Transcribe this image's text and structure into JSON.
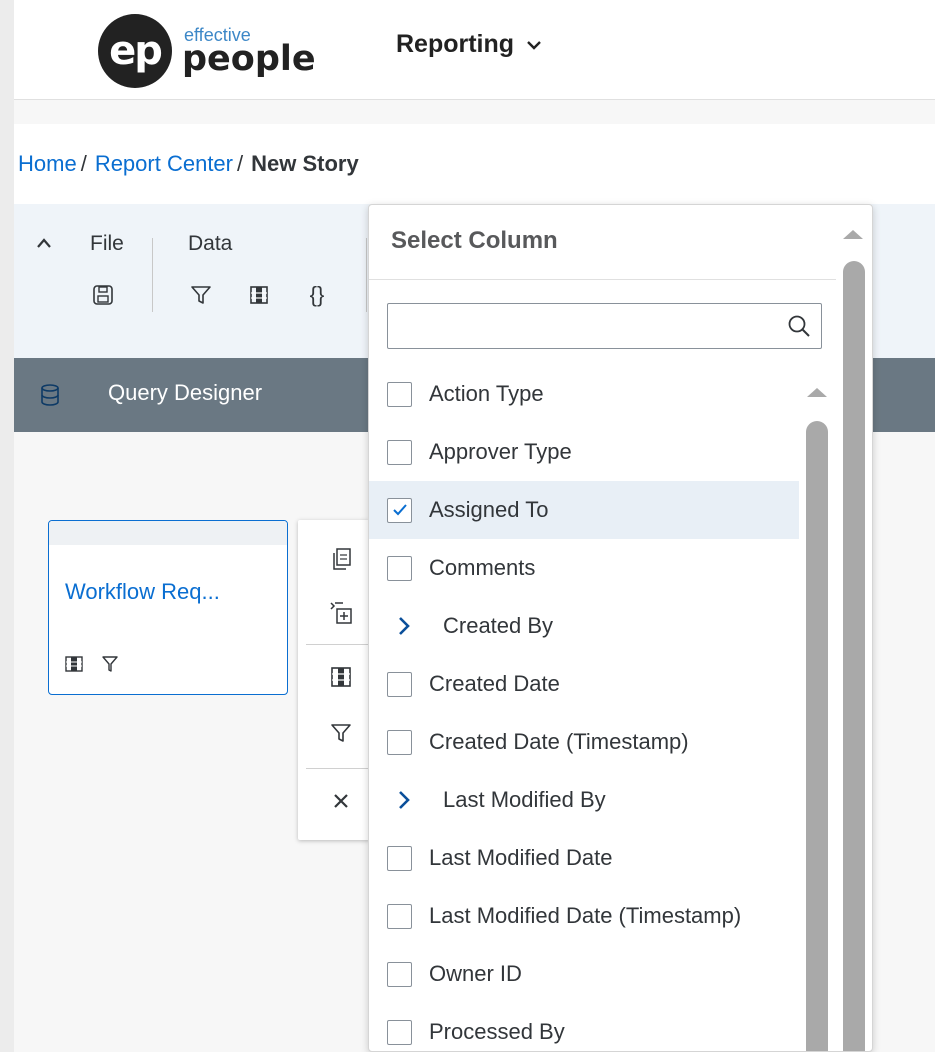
{
  "header": {
    "logo_mark": "ep",
    "logo_small": "effective",
    "logo_big": "people",
    "app_menu_label": "Reporting"
  },
  "breadcrumb": {
    "home": "Home",
    "report_center": "Report Center",
    "separator": "/",
    "current": "New Story"
  },
  "toolbar": {
    "file_label": "File",
    "data_label": "Data",
    "icons": [
      "chevron-up-icon",
      "save-icon",
      "filter-icon",
      "columns-icon",
      "braces-icon"
    ]
  },
  "query_designer": {
    "label": "Query Designer",
    "icon": "database-icon"
  },
  "card": {
    "title": "Workflow Req...",
    "icons": [
      "columns-icon",
      "filter-icon"
    ]
  },
  "action_bar": {
    "icons": [
      "copy-icon",
      "add-row-icon",
      "columns-icon",
      "filter-icon",
      "close-icon"
    ]
  },
  "select_column": {
    "title": "Select Column",
    "search_value": "",
    "items": [
      {
        "label": "Action Type",
        "type": "checkbox",
        "checked": false
      },
      {
        "label": "Approver Type",
        "type": "checkbox",
        "checked": false
      },
      {
        "label": "Assigned To",
        "type": "checkbox",
        "checked": true
      },
      {
        "label": "Comments",
        "type": "checkbox",
        "checked": false
      },
      {
        "label": "Created By",
        "type": "expandable"
      },
      {
        "label": "Created Date",
        "type": "checkbox",
        "checked": false
      },
      {
        "label": "Created Date (Timestamp)",
        "type": "checkbox",
        "checked": false
      },
      {
        "label": "Last Modified By",
        "type": "expandable"
      },
      {
        "label": "Last Modified Date",
        "type": "checkbox",
        "checked": false
      },
      {
        "label": "Last Modified Date (Timestamp)",
        "type": "checkbox",
        "checked": false
      },
      {
        "label": "Owner ID",
        "type": "checkbox",
        "checked": false
      },
      {
        "label": "Processed By",
        "type": "checkbox",
        "checked": false
      }
    ]
  },
  "colors": {
    "link": "#0a6ed1",
    "toolbar_bg": "#eff4f9",
    "query_bar_bg": "#6a7883",
    "selected_row_bg": "#e8eff6",
    "scroll_thumb": "#a9a9a9"
  }
}
